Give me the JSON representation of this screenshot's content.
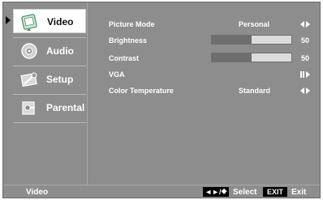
{
  "sidebar": {
    "items": [
      {
        "label": "Video",
        "icon": "video-icon",
        "selected": true
      },
      {
        "label": "Audio",
        "icon": "audio-icon",
        "selected": false
      },
      {
        "label": "Setup",
        "icon": "setup-icon",
        "selected": false
      },
      {
        "label": "Parental",
        "icon": "parental-icon",
        "selected": false
      }
    ]
  },
  "settings": [
    {
      "name": "Picture Mode",
      "value": "Personal",
      "control": "left-right"
    },
    {
      "name": "Brightness",
      "level": 50,
      "value": "50",
      "control": "slider"
    },
    {
      "name": "Contrast",
      "level": 50,
      "value": "50",
      "control": "slider"
    },
    {
      "name": "VGA",
      "control": "enter"
    },
    {
      "name": "Color Temperature",
      "value": "Standard",
      "control": "left-right"
    }
  ],
  "footer": {
    "title": "Video",
    "select_key": "◄►/⯁",
    "select_label": "Select",
    "exit_key": "EXIT",
    "exit_label": "Exit"
  },
  "colors": {
    "panel": "#8d8d8d",
    "text": "#ffffff",
    "slider_track": "#dcdcdc",
    "slider_fill": "#6e6e6e"
  }
}
